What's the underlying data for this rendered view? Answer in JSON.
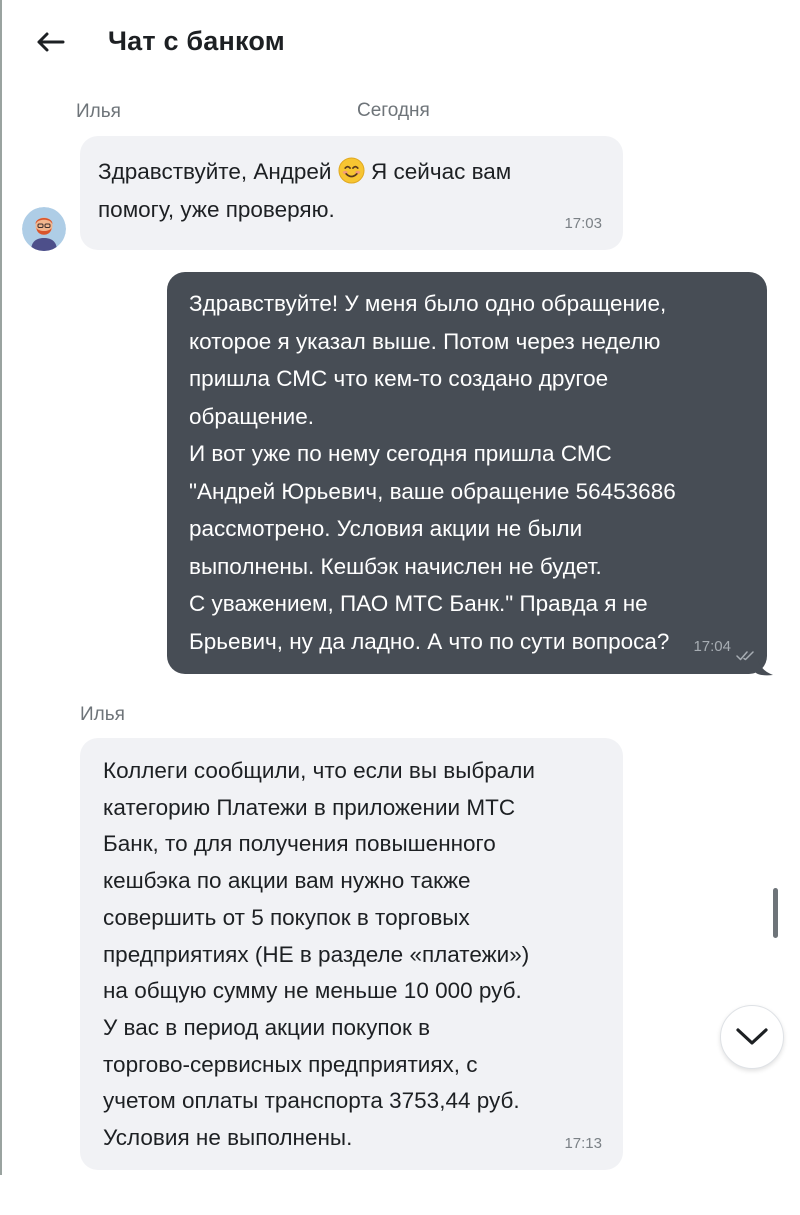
{
  "header": {
    "title": "Чат с банком",
    "back_icon": "arrow-left-icon"
  },
  "chat": {
    "date_label": "Сегодня",
    "messages": [
      {
        "direction": "incoming",
        "sender": "Илья",
        "text_before_emoji": "Здравствуйте, Андрей ",
        "emoji": "smiling-face-emoji",
        "text_after_emoji": " Я сейчас вам\nпомогу, уже проверяю.",
        "time": "17:03"
      },
      {
        "direction": "outgoing",
        "text": "Здравствуйте! У меня было одно обращение,\nкоторое я указал выше. Потом  через неделю\nпришла СМС что кем-то создано другое\nобращение.\nИ вот уже по нему сегодня пришла СМС\n\"Андрей Юрьевич, ваше обращение 56453686\nрассмотрено. Условия акции не были\nвыполнены. Кешбэк начислен не будет.\nС уважением, ПАО МТС Банк.\"  Правда я не\nБрьевич, ну да ладно.  А что по сути вопроса?",
        "time": "17:04",
        "status_icon": "double-check-icon"
      },
      {
        "direction": "incoming",
        "sender": "Илья",
        "text": "Коллеги сообщили, что если вы выбрали\nкатегорию Платежи в приложении МТС\nБанк, то для получения повышенного\nкешбэка по акции вам нужно также\nсовершить от 5 покупок в торговых\nпредприятиях (НЕ в разделе «платежи»)\nна общую сумму не меньше 10 000 руб.\nУ вас в период акции покупок в\nторгово-сервисных предприятиях, с\nучетом оплаты транспорта 3753,44 руб.\nУсловия не выполнены.",
        "time": "17:13"
      }
    ]
  },
  "controls": {
    "scroll_down_icon": "chevron-down-icon"
  },
  "colors": {
    "incoming_bubble": "#f1f2f5",
    "outgoing_bubble": "#474d55",
    "muted_text": "#6e7479"
  }
}
